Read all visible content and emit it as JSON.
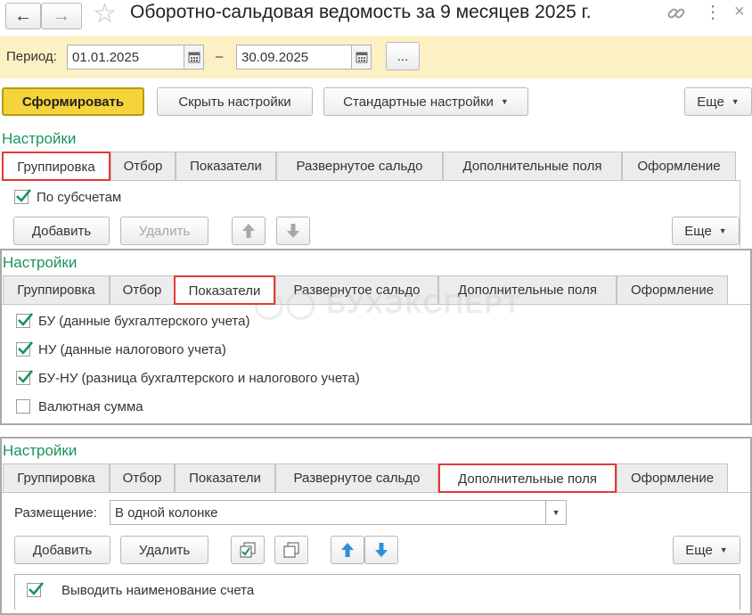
{
  "window": {
    "title": "Оборотно-сальдовая ведомость за 9 месяцев 2025 г."
  },
  "period": {
    "label": "Период:",
    "from": "01.01.2025",
    "separator": "–",
    "to": "30.09.2025",
    "more_label": "..."
  },
  "toolbar": {
    "generate": "Сформировать",
    "hide_settings": "Скрыть настройки",
    "standard_settings": "Стандартные настройки",
    "more": "Еще"
  },
  "tab_labels": [
    "Группировка",
    "Отбор",
    "Показатели",
    "Развернутое сальдо",
    "Дополнительные поля",
    "Оформление"
  ],
  "panel1": {
    "title": "Настройки",
    "active_tab": "Группировка",
    "checkbox": {
      "label": "По субсчетам",
      "checked": true
    },
    "add": "Добавить",
    "delete": "Удалить",
    "more": "Еще"
  },
  "panel2": {
    "title": "Настройки",
    "active_tab": "Показатели",
    "watermark": "БУХЭКСПЕРТ",
    "items": [
      {
        "label": "БУ (данные бухгалтерского учета)",
        "checked": true
      },
      {
        "label": "НУ (данные налогового учета)",
        "checked": true
      },
      {
        "label": "БУ-НУ (разница бухгалтерского и налогового учета)",
        "checked": true
      },
      {
        "label": "Валютная сумма",
        "checked": false
      }
    ]
  },
  "panel3": {
    "title": "Настройки",
    "active_tab": "Дополнительные поля",
    "placement_label": "Размещение:",
    "placement_value": "В одной колонке",
    "add": "Добавить",
    "delete": "Удалить",
    "more": "Еще",
    "row": {
      "label": "Выводить наименование счета",
      "checked": true
    }
  },
  "colors": {
    "accent_green": "#19945c",
    "highlight_red": "#e53935",
    "primary_button": "#f5d33b",
    "period_bar": "#fcf1c4"
  }
}
